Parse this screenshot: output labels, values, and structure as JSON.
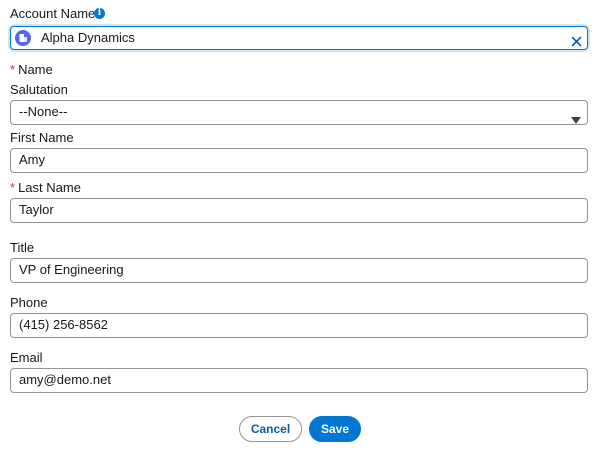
{
  "account": {
    "label": "Account Name",
    "value": "Alpha Dynamics",
    "icon": "account-icon",
    "clear_icon": "close-icon"
  },
  "name_section": {
    "label": "Name",
    "required_mark": "*"
  },
  "salutation": {
    "label": "Salutation",
    "value": "--None--"
  },
  "first_name": {
    "label": "First Name",
    "value": "Amy"
  },
  "last_name": {
    "label": "Last Name",
    "required_mark": "*",
    "value": "Taylor"
  },
  "title": {
    "label": "Title",
    "value": "VP of Engineering"
  },
  "phone": {
    "label": "Phone",
    "value": "(415) 256-8562"
  },
  "email": {
    "label": "Email",
    "value": "amy@demo.net"
  },
  "actions": {
    "cancel_label": "Cancel",
    "save_label": "Save"
  },
  "colors": {
    "brand": "#0176d3",
    "required": "#c23934",
    "account_icon": "#5867e8"
  }
}
